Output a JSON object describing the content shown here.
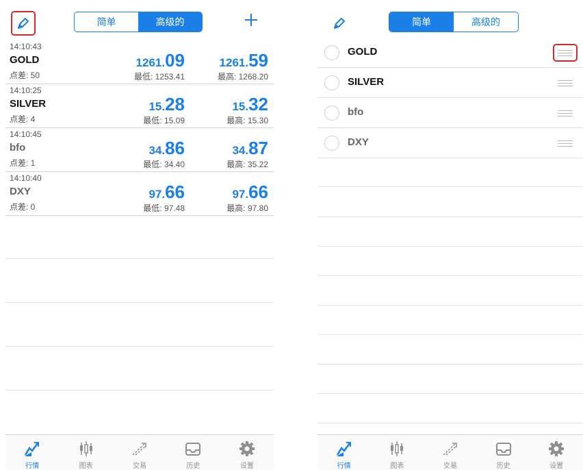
{
  "left": {
    "segment": {
      "simple": "简单",
      "advanced": "高级的"
    },
    "quotes": [
      {
        "time": "14:10:43",
        "symbol": "GOLD",
        "spread": "点差: 50",
        "bid_small": "1261.",
        "bid_big": "09",
        "ask_small": "1261.",
        "ask_big": "59",
        "low": "最低: 1253.41",
        "high": "最高: 1268.20"
      },
      {
        "time": "14:10:25",
        "symbol": "SILVER",
        "spread": "点差: 4",
        "bid_small": "15.",
        "bid_big": "28",
        "ask_small": "15.",
        "ask_big": "32",
        "low": "最低: 15.09",
        "high": "最高: 15.30"
      },
      {
        "time": "14:10:45",
        "symbol": "bfo",
        "spread": "点差: 1",
        "bid_small": "34.",
        "bid_big": "86",
        "ask_small": "34.",
        "ask_big": "87",
        "low": "最低: 34.40",
        "high": "最高: 35.22"
      },
      {
        "time": "14:10:40",
        "symbol": "DXY",
        "spread": "点差: 0",
        "bid_small": "97.",
        "bid_big": "66",
        "ask_small": "97.",
        "ask_big": "66",
        "low": "最低: 97.48",
        "high": "最高: 97.80"
      }
    ]
  },
  "right": {
    "segment": {
      "simple": "简单",
      "advanced": "高级的"
    },
    "symbols": [
      "GOLD",
      "SILVER",
      "bfo",
      "DXY"
    ]
  },
  "tabbar": {
    "tabs": [
      {
        "label": "行情",
        "icon": "quotes-icon"
      },
      {
        "label": "图表",
        "icon": "candlestick-chart-icon"
      },
      {
        "label": "交易",
        "icon": "trade-icon"
      },
      {
        "label": "历史",
        "icon": "history-inbox-icon"
      },
      {
        "label": "设置",
        "icon": "gear-icon"
      }
    ]
  },
  "colors": {
    "accent": "#1a7fe6",
    "highlight": "#d9262e"
  }
}
